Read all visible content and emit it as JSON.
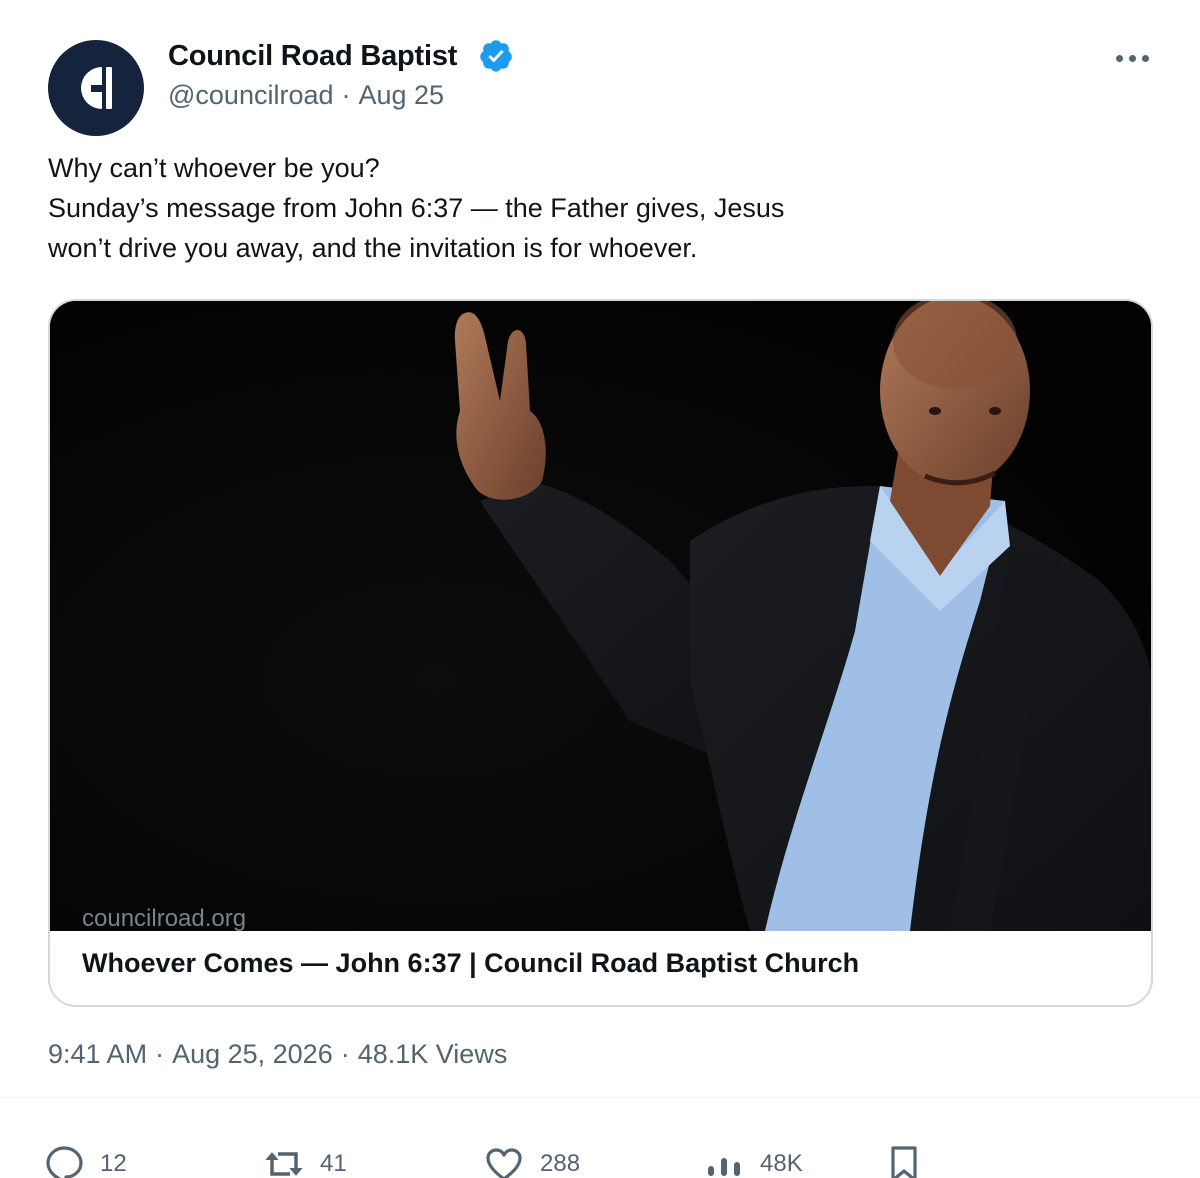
{
  "author": {
    "name": "Council Road Baptist",
    "handle": "@councilroad",
    "date": "Aug 25",
    "verified": true,
    "avatar_icon": "church-logo-icon"
  },
  "post": {
    "lines": [
      "Why can’t whoever be you?",
      "Sunday’s message from John 6:37 — the Father gives, Jesus",
      "won’t drive you away, and the invitation is for whoever."
    ]
  },
  "card": {
    "domain": "councilroad.org",
    "title": "Whoever Comes — John 6:37 | Council Road Baptist Church",
    "media_description_icon": "video-thumbnail-preacher"
  },
  "meta": {
    "time": "9:41 AM",
    "date": "Aug 25, 2026",
    "views": "48.1K Views"
  },
  "actions": {
    "replies": "12",
    "reposts": "41",
    "likes": "288",
    "views": "48K"
  },
  "colors": {
    "text": "#0f1419",
    "secondary": "#536471",
    "verified": "#1d9bf0",
    "avatar": "#15233d",
    "border": "#cfd9de"
  }
}
